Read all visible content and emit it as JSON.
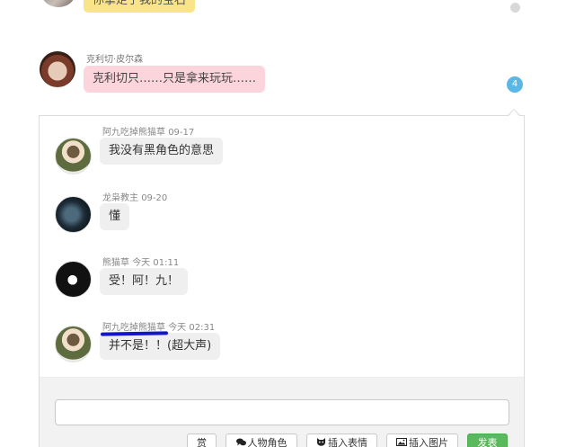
{
  "top_message": {
    "text": "你拿走了我的宝石"
  },
  "message": {
    "author": "克利切·皮尔森",
    "text": "克利切只……只是拿来玩玩……",
    "reply_count": "4"
  },
  "replies": [
    {
      "author": "阿九吃掉熊猫草",
      "time": "09-17",
      "text": "我没有黑角色的意思"
    },
    {
      "author": "龙枭教主",
      "time": "09-20",
      "text": "懂"
    },
    {
      "author": "熊猫草",
      "time": "今天 01:11",
      "text": "受！阿！九！"
    },
    {
      "author": "阿九吃掉熊猫草",
      "time": "今天 02:31",
      "text": "并不是！！(超大声)"
    }
  ],
  "compose": {
    "input_value": "",
    "reward_label": "赏",
    "character_label": "人物角色",
    "emoji_label": "插入表情",
    "image_label": "插入图片",
    "send_label": "发表"
  },
  "icons": {
    "character": "speech-bubbles-icon",
    "emoji": "cat-face-icon",
    "image": "picture-icon"
  },
  "colors": {
    "top_bubble": "#f9e48a",
    "message_bubble": "#fbd4dc",
    "reply_bubble": "#efefef",
    "badge": "#5bb7e5",
    "send_button": "#5cb85c",
    "annotation_underline": "#1414c8"
  }
}
